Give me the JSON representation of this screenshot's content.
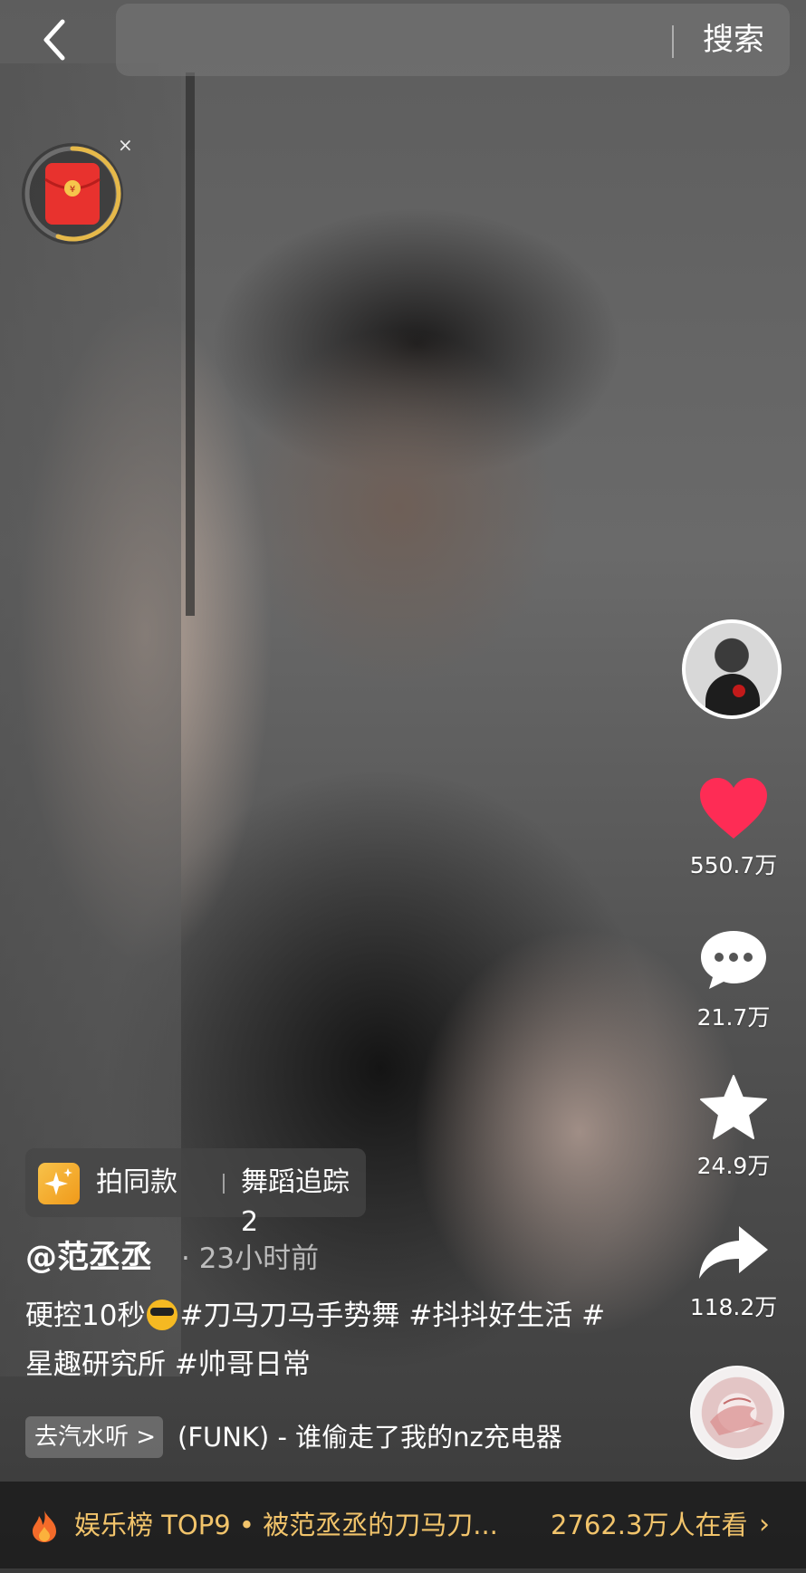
{
  "topbar": {
    "back_icon": "chevron-left-icon",
    "search_label": "搜索"
  },
  "red_packet": {
    "icon": "red-envelope-icon",
    "close_label": "×"
  },
  "sidebar": {
    "likes": "550.7万",
    "comments": "21.7万",
    "favorites": "24.9万",
    "shares": "118.2万"
  },
  "template": {
    "label": "拍同款",
    "name": "舞蹈追踪2"
  },
  "post": {
    "author": "@范丞丞",
    "time": "· 23小时前",
    "caption_prefix": "硬控10秒",
    "tags": [
      "#刀马刀马手势舞",
      "#抖抖好生活",
      "#星趣研究所",
      "#帅哥日常"
    ]
  },
  "music": {
    "chip_label": "去汽水听 >",
    "title": "(FUNK) - 谁偷走了我的nz充电器"
  },
  "hotbar": {
    "text": "娱乐榜 TOP9 • 被范丞丞的刀马刀...",
    "viewers": "2762.3万人在看",
    "chevron": "›"
  },
  "colors": {
    "like_red": "#fe2c55",
    "hot_gold": "#f2c46b",
    "red_packet": "#e8322e"
  }
}
